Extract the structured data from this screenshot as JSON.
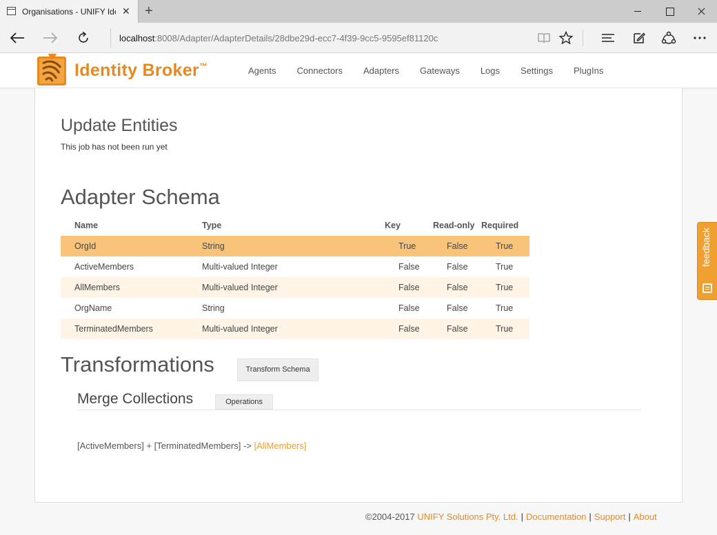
{
  "browser": {
    "tab_title": "Organisations - UNIFY Identity Broker",
    "url_host": "localhost",
    "url_rest": ":8008/Adapter/AdapterDetails/28dbe29d-ecc7-4f39-9cc5-9595ef81120c",
    "icons": {
      "back": "arrow-left-icon",
      "forward": "arrow-right-icon",
      "refresh": "refresh-icon",
      "reading_view": "book-icon",
      "favorite": "star-icon",
      "hub": "hamburger-icon",
      "notes": "pen-icon",
      "share": "share-icon",
      "more": "ellipsis-icon"
    }
  },
  "app": {
    "brand": "Identity Broker",
    "brand_tm": "™",
    "accent_color": "#e8891d",
    "menu": [
      {
        "label": "Agents"
      },
      {
        "label": "Connectors"
      },
      {
        "label": "Adapters"
      },
      {
        "label": "Gateways"
      },
      {
        "label": "Logs"
      },
      {
        "label": "Settings"
      },
      {
        "label": "PlugIns"
      }
    ]
  },
  "update": {
    "title": "Update Entities",
    "status": "This job has not been run yet"
  },
  "schema": {
    "title": "Adapter Schema",
    "headers": {
      "name": "Name",
      "type": "Type",
      "key": "Key",
      "readonly": "Read-only",
      "required": "Required"
    },
    "rows": [
      {
        "name": "OrgId",
        "type": "String",
        "key": "True",
        "readonly": "False",
        "required": "True"
      },
      {
        "name": "ActiveMembers",
        "type": "Multi-valued Integer",
        "key": "False",
        "readonly": "False",
        "required": "True"
      },
      {
        "name": "AllMembers",
        "type": "Multi-valued Integer",
        "key": "False",
        "readonly": "False",
        "required": "True"
      },
      {
        "name": "OrgName",
        "type": "String",
        "key": "False",
        "readonly": "False",
        "required": "True"
      },
      {
        "name": "TerminatedMembers",
        "type": "Multi-valued Integer",
        "key": "False",
        "readonly": "False",
        "required": "True"
      }
    ]
  },
  "transformations": {
    "title": "Transformations",
    "transform_button": "Transform Schema",
    "merge_title": "Merge Collections",
    "operations_button": "Operations",
    "rule_source": "[ActiveMembers] + [TerminatedMembers] ->",
    "rule_target": "[AllMembers]"
  },
  "footer": {
    "copyright": "©2004-2017",
    "company": "UNIFY Solutions Pty. Ltd.",
    "documentation": "Documentation",
    "support": "Support",
    "about": "About",
    "separator": "|"
  },
  "feedback": {
    "label": "feedback"
  }
}
